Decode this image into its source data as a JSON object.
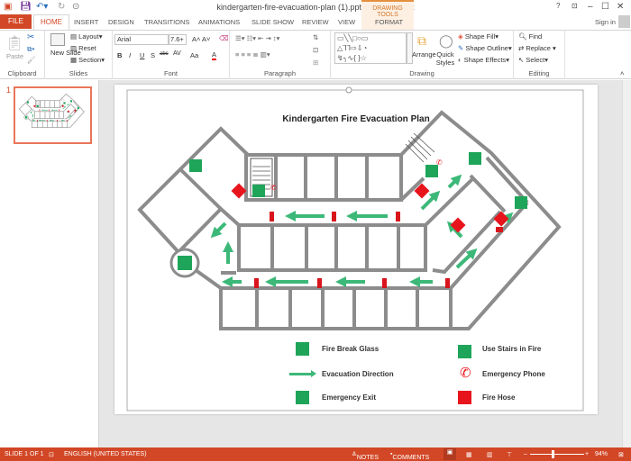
{
  "window": {
    "title": "kindergarten-fire-evacuation-plan (1).pptx - PowerPoint",
    "contextual_tab": "DRAWING TOOLS",
    "help": "?",
    "minimize": "–",
    "maximize": "☐",
    "close": "✕",
    "sign_in": "Sign in"
  },
  "tabs": [
    "FILE",
    "HOME",
    "INSERT",
    "DESIGN",
    "TRANSITIONS",
    "ANIMATIONS",
    "SLIDE SHOW",
    "REVIEW",
    "VIEW",
    "FORMAT"
  ],
  "ribbon": {
    "clipboard": {
      "label": "Clipboard",
      "paste": "Paste"
    },
    "slides": {
      "label": "Slides",
      "new_slide": "New Slide",
      "layout": "Layout",
      "reset": "Reset",
      "section": "Section"
    },
    "font": {
      "label": "Font",
      "font_name": "Arial",
      "font_size": "7.6+",
      "bold": "B",
      "italic": "I",
      "underline": "U",
      "shadow": "S",
      "strike": "abc",
      "spacing": "AV",
      "case": "Aa",
      "color": "A"
    },
    "paragraph": {
      "label": "Paragraph"
    },
    "drawing": {
      "label": "Drawing",
      "arrange": "Arrange",
      "quick_styles": "Quick Styles",
      "shape_fill": "Shape Fill",
      "shape_outline": "Shape Outline",
      "shape_effects": "Shape Effects"
    },
    "editing": {
      "label": "Editing",
      "find": "Find",
      "replace": "Replace",
      "select": "Select"
    }
  },
  "thumbnails": [
    {
      "number": "1"
    }
  ],
  "slide": {
    "title": "Kindergarten Fire Evacuation Plan",
    "legend": [
      {
        "label": "Fire Break Glass",
        "icon": "fire-break-glass-icon"
      },
      {
        "label": "Use Stairs in Fire",
        "icon": "use-stairs-icon"
      },
      {
        "label": "Evacuation Direction",
        "icon": "evacuation-arrow-icon"
      },
      {
        "label": "Emergency Phone",
        "icon": "emergency-phone-icon"
      },
      {
        "label": "Emergency Exit",
        "icon": "emergency-exit-icon"
      },
      {
        "label": "Fire Hose",
        "icon": "fire-hose-icon"
      }
    ],
    "colors": {
      "green": "#1ea55a",
      "arrow": "#3cb878",
      "red": "#e8141c",
      "wall": "#8c8c8c"
    }
  },
  "status": {
    "slide": "SLIDE 1 OF 1",
    "language": "ENGLISH (UNITED STATES)",
    "notes": "NOTES",
    "comments": "COMMENTS",
    "zoom": "94%"
  }
}
